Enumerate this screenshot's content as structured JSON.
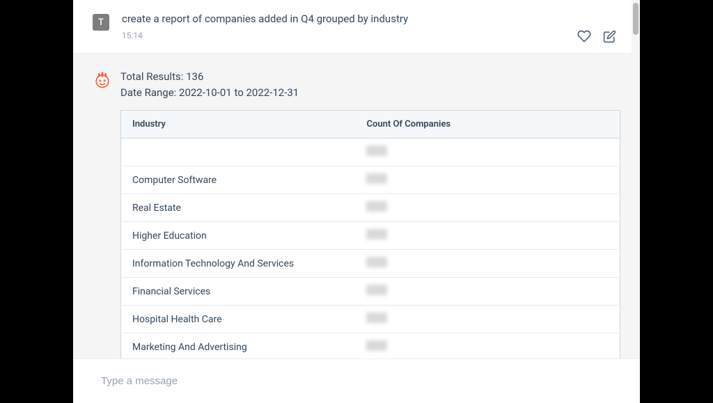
{
  "user_message": {
    "avatar_letter": "T",
    "text": "create a report of companies added in Q4 grouped by industry",
    "timestamp": "15:14"
  },
  "bot_response": {
    "total_results_label": "Total Results:",
    "total_results_value": "136",
    "date_range_label": "Date Range:",
    "date_range_value": "2022-10-01 to 2022-12-31",
    "table": {
      "headers": {
        "industry": "Industry",
        "count": "Count Of Companies"
      },
      "rows": [
        {
          "industry": ""
        },
        {
          "industry": "Computer Software"
        },
        {
          "industry": "Real Estate"
        },
        {
          "industry": "Higher Education"
        },
        {
          "industry": "Information Technology And Services"
        },
        {
          "industry": "Financial Services"
        },
        {
          "industry": "Hospital Health Care"
        },
        {
          "industry": "Marketing And Advertising"
        }
      ]
    }
  },
  "composer": {
    "placeholder": "Type a message"
  }
}
